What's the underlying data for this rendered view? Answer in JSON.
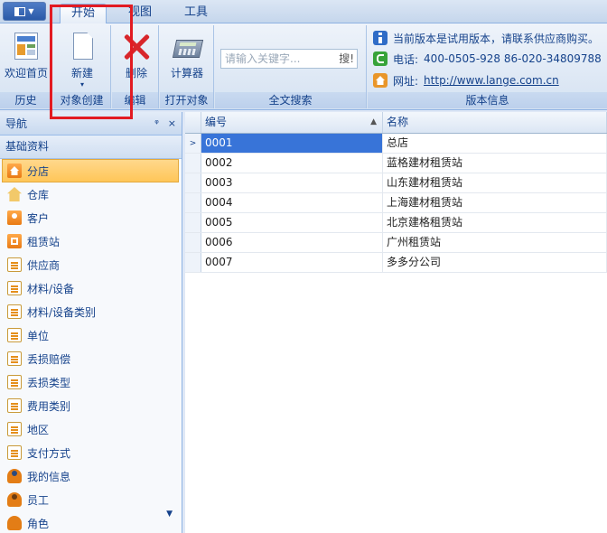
{
  "tabs": [
    {
      "label": "开始",
      "active": true
    },
    {
      "label": "视图",
      "active": false
    },
    {
      "label": "工具",
      "active": false
    }
  ],
  "ribbon": {
    "groups": {
      "history": {
        "label": "历史",
        "button": "欢迎首页"
      },
      "object_create": {
        "label": "对象创建",
        "button": "新建"
      },
      "edit": {
        "label": "编辑",
        "button": "删除"
      },
      "open_object": {
        "label": "打开对象",
        "button": "计算器"
      },
      "fulltext": {
        "label": "全文搜索",
        "placeholder": "请输入关键字...",
        "search_button": "搜!"
      },
      "version": {
        "label": "版本信息",
        "notice": "当前版本是试用版本，请联系供应商购买。",
        "phone_label": "电话:",
        "phone_value": "400-0505-928  86-020-34809788",
        "site_label": "网址:",
        "site_value": "http://www.lange.com.cn"
      }
    }
  },
  "nav": {
    "title": "导航",
    "pin": "ᵠ",
    "close": "×",
    "section": "基础资料",
    "items": [
      {
        "label": "分店",
        "icon": "house-icon",
        "selected": true
      },
      {
        "label": "仓库",
        "icon": "warehouse-icon"
      },
      {
        "label": "客户",
        "icon": "customer-icon"
      },
      {
        "label": "租赁站",
        "icon": "rental-station-icon"
      },
      {
        "label": "供应商",
        "icon": "supplier-icon"
      },
      {
        "label": "材料/设备",
        "icon": "material-icon"
      },
      {
        "label": "材料/设备类别",
        "icon": "material-category-icon"
      },
      {
        "label": "单位",
        "icon": "unit-icon"
      },
      {
        "label": "丢损赔偿",
        "icon": "loss-compensation-icon"
      },
      {
        "label": "丢损类型",
        "icon": "loss-type-icon"
      },
      {
        "label": "费用类别",
        "icon": "fee-category-icon"
      },
      {
        "label": "地区",
        "icon": "region-icon"
      },
      {
        "label": "支付方式",
        "icon": "payment-icon"
      },
      {
        "label": "我的信息",
        "icon": "my-info-icon"
      },
      {
        "label": "员工",
        "icon": "employee-icon"
      },
      {
        "label": "角色",
        "icon": "role-icon"
      }
    ]
  },
  "grid": {
    "columns": [
      "编号",
      "名称"
    ],
    "rows": [
      {
        "code": "0001",
        "name": "总店"
      },
      {
        "code": "0002",
        "name": "蓝格建材租赁站"
      },
      {
        "code": "0003",
        "name": "山东建材租赁站"
      },
      {
        "code": "0004",
        "name": "上海建材租赁站"
      },
      {
        "code": "0005",
        "name": "北京建格租赁站"
      },
      {
        "code": "0006",
        "name": "广州租赁站"
      },
      {
        "code": "0007",
        "name": "多多分公司"
      }
    ]
  },
  "colors": {
    "accent": "#15428b",
    "selection": "#3874d8",
    "highlight": "#e21b22"
  }
}
